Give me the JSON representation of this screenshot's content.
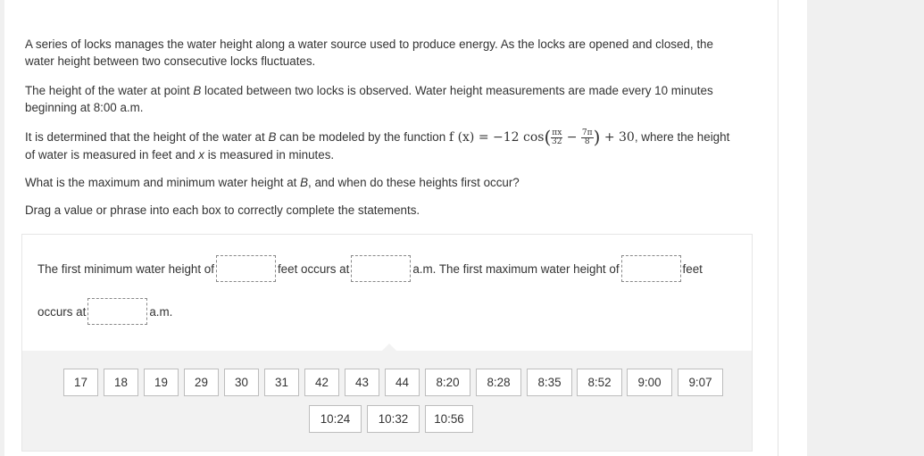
{
  "question": {
    "paragraph1": "A series of locks manages the water height along a water source used to produce energy. As the locks are opened and closed, the water height between two consecutive locks fluctuates.",
    "paragraph2": {
      "before": "The height of the water at point ",
      "var": "B",
      "after": " located between two locks is observed. Water height measurements are made every 10 minutes beginning at 8:00 a.m."
    },
    "paragraph3": {
      "before": "It is determined that the height of the water at ",
      "var_b": "B",
      "mid": " can be modeled by the function ",
      "after1": ", where the height of water is measured in feet and ",
      "var_x": "x",
      "after2": " is measured in minutes.",
      "formula": {
        "lhs": "f (x) = −12 cos",
        "frac1_num": "πx",
        "frac1_den": "32",
        "minus": "−",
        "frac2_num": "7π",
        "frac2_den": "8",
        "rhs": "+ 30"
      }
    },
    "paragraph4": {
      "before": "What is the maximum and minimum water height at ",
      "var": "B",
      "after": ", and when do these heights first occur?"
    },
    "instruction": "Drag a value or phrase into each box to correctly complete the statements."
  },
  "statements": {
    "text1": "The first minimum water height of",
    "text2": "feet occurs at",
    "text3": "a.m. The first maximum water height of",
    "text4": "feet",
    "text5": "occurs at",
    "text6": "a.m."
  },
  "tiles": [
    "17",
    "18",
    "19",
    "29",
    "30",
    "31",
    "42",
    "43",
    "44",
    "8:20",
    "8:28",
    "8:35",
    "8:52",
    "9:00",
    "9:07",
    "10:24",
    "10:32",
    "10:56"
  ]
}
